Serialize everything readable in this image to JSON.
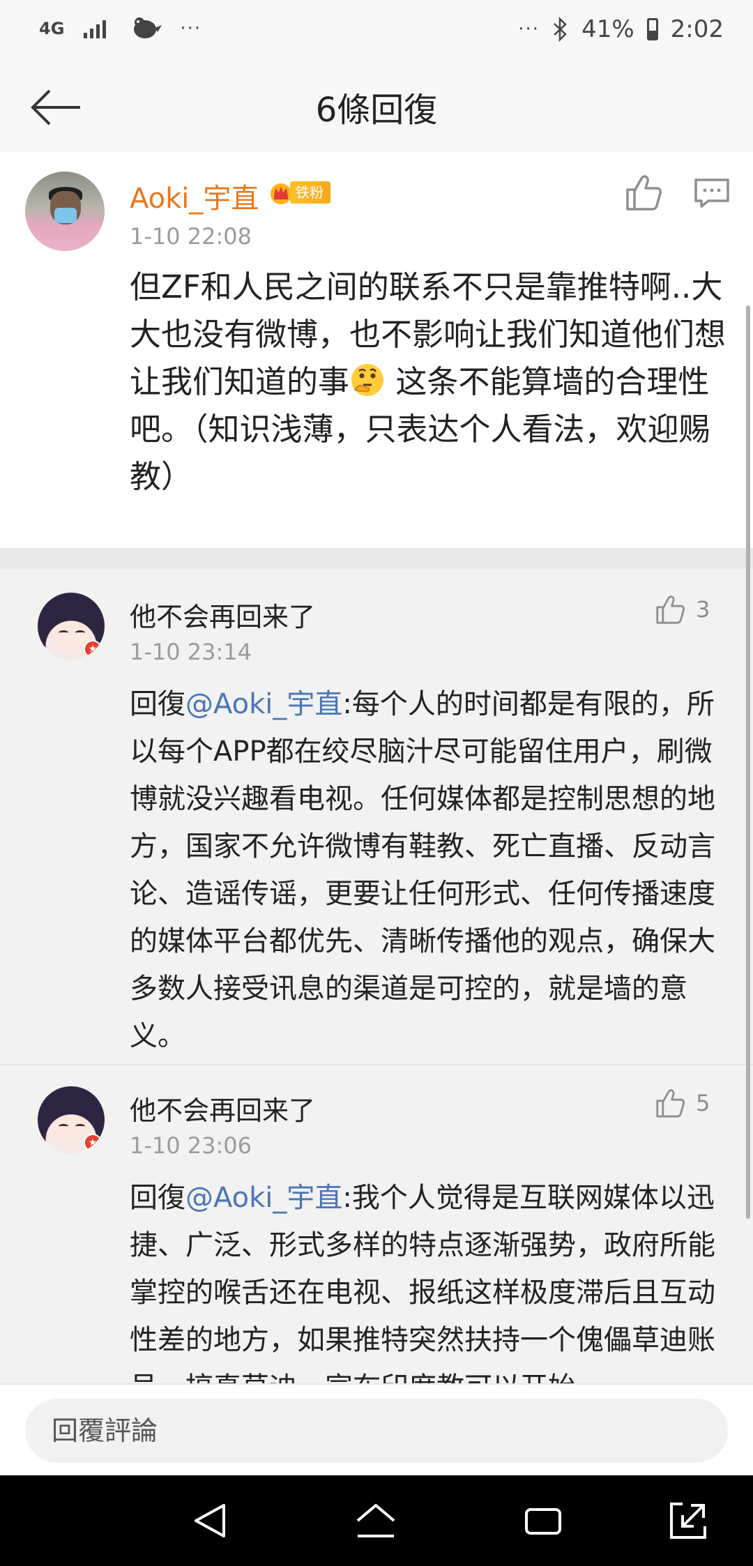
{
  "status_bar": {
    "network_label": "4G",
    "overflow_left": "···",
    "overflow_right": "···",
    "battery": "41%",
    "time": "2:02",
    "battery_level": 0.41
  },
  "header": {
    "title": "6條回復"
  },
  "main_comment": {
    "author": "Aoki_宇直",
    "badge": "铁粉",
    "time": "1-10 22:08",
    "text_before_emoji": "但ZF和人民之间的联系不只是靠推特啊..大大也没有微博，也不影响让我们知道他们想让我们知道的事",
    "emoji": "thinking-face",
    "text_after_emoji": " 这条不能算墙的合理性吧。（知识浅薄，只表达个人看法，欢迎赐教）"
  },
  "replies": [
    {
      "author": "他不会再回来了",
      "time": "1-10 23:14",
      "likes": "3",
      "prefix": "回復",
      "mention": "@Aoki_宇直",
      "text": ":每个人的时间都是有限的，所以每个APP都在绞尽脑汁尽可能留住用户，刷微博就没兴趣看电视。任何媒体都是控制思想的地方，国家不允许微博有鞋教、死亡直播、反动言论、造谣传谣，更要让任何形式、任何传播速度的媒体平台都优先、清晰传播他的观点，确保大多数人接受讯息的渠道是可控的，就是墙的意义。"
    },
    {
      "author": "他不会再回来了",
      "time": "1-10 23:06",
      "likes": "5",
      "prefix": "回復",
      "mention": "@Aoki_宇直",
      "text": ":我个人觉得是互联网媒体以迅捷、广泛、形式多样的特点逐渐强势，政府所能掌控的喉舌还在电视、报纸这样极度滞后且互动性差的地方，如果推特突然扶持一个傀儡草迪账号，搞真草迪，宣布印度教可以开始"
    }
  ],
  "footer": {
    "reply_placeholder": "回覆評論"
  },
  "icons": {
    "back": "back-arrow-icon",
    "like": "thumbs-up-icon",
    "comment": "comment-icon",
    "nav_back": "nav-back-icon",
    "nav_home": "nav-home-icon",
    "nav_recents": "nav-recents-icon",
    "nav_rotate": "nav-rotate-icon"
  },
  "colors": {
    "author_orange": "#e8781e",
    "mention_blue": "#4a77b5",
    "badge_gold": "#ffc02b"
  }
}
